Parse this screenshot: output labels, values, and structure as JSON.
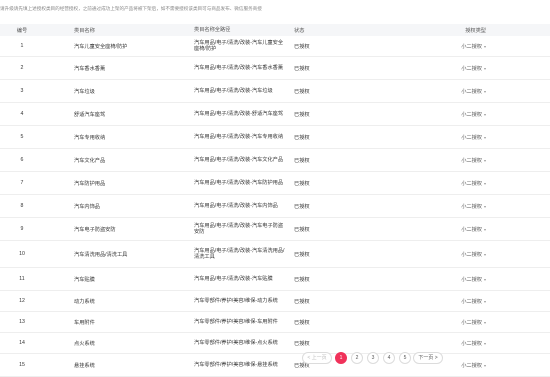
{
  "notice": "请升级请先填上述授权类目的经营授权，之前通过成功上架的产品将被下架后，如不需要授权该类目可与商品发布、微信服务商授",
  "table": {
    "headers": {
      "index": "编号",
      "name": "类目名称",
      "path": "类目名称全路径",
      "status": "状态",
      "type": "授权类型"
    },
    "rows": [
      {
        "index": "1",
        "name": "汽车儿童安全座椅/防护",
        "path": "汽车用品/电子/清洗/改装-汽车儿童安全座椅/防护",
        "status": "已授权",
        "type": "小二授权"
      },
      {
        "index": "2",
        "name": "汽车香水香薰",
        "path": "汽车用品/电子/清洗/改装-汽车香水香薰",
        "status": "已授权",
        "type": "小二授权"
      },
      {
        "index": "3",
        "name": "汽车垃圾",
        "path": "汽车用品/电子/清洗/改装-汽车垃圾",
        "status": "已授权",
        "type": "小二授权"
      },
      {
        "index": "4",
        "name": "舒适汽车座驾",
        "path": "汽车用品/电子/清洗/改装-舒适汽车座驾",
        "status": "已授权",
        "type": "小二授权"
      },
      {
        "index": "5",
        "name": "汽车专用收纳",
        "path": "汽车用品/电子/清洗/改装-汽车专用收纳",
        "status": "已授权",
        "type": "小二授权"
      },
      {
        "index": "6",
        "name": "汽车文化产品",
        "path": "汽车用品/电子/清洗/改装-汽车文化产品",
        "status": "已授权",
        "type": "小二授权"
      },
      {
        "index": "7",
        "name": "汽车防护用品",
        "path": "汽车用品/电子/清洗/改装-汽车防护用品",
        "status": "已授权",
        "type": "小二授权"
      },
      {
        "index": "8",
        "name": "汽车内饰品",
        "path": "汽车用品/电子/清洗/改装-汽车内饰品",
        "status": "已授权",
        "type": "小二授权"
      },
      {
        "index": "9",
        "name": "汽车电子防盗安防",
        "path": "汽车用品/电子/清洗/改装-汽车电子防盗安防",
        "status": "已授权",
        "type": "小二授权"
      },
      {
        "index": "10",
        "name": "汽车清洗用品/清洗工具",
        "path": "汽车用品/电子/清洗/改装-汽车清洗用品/清洗工具",
        "status": "已授权",
        "type": "小二授权"
      },
      {
        "index": "11",
        "name": "汽车贴膜",
        "path": "汽车用品/电子/清洗/改装-汽车贴膜",
        "status": "已授权",
        "type": "小二授权"
      },
      {
        "index": "12",
        "name": "动力系统",
        "path": "汽车零部件/养护/美容/维保-动力系统",
        "status": "已授权",
        "type": "小二授权"
      },
      {
        "index": "13",
        "name": "车用附件",
        "path": "汽车零部件/养护/美容/维保-车用附件",
        "status": "已授权",
        "type": "小二授权"
      },
      {
        "index": "14",
        "name": "点火系统",
        "path": "汽车零部件/养护/美容/维保-点火系统",
        "status": "已授权",
        "type": "小二授权"
      },
      {
        "index": "15",
        "name": "悬挂系统",
        "path": "汽车零部件/养护/美容/维保-悬挂系统",
        "status": "已授权",
        "type": "小二授权"
      }
    ]
  },
  "pagination": {
    "prev": "< 上一页",
    "pages": [
      "1",
      "2",
      "3",
      "4",
      "5"
    ],
    "current": "1",
    "next": "下一页 >"
  },
  "colors": {
    "accent": "#f0325a",
    "header_bg": "#f5f6f8"
  }
}
